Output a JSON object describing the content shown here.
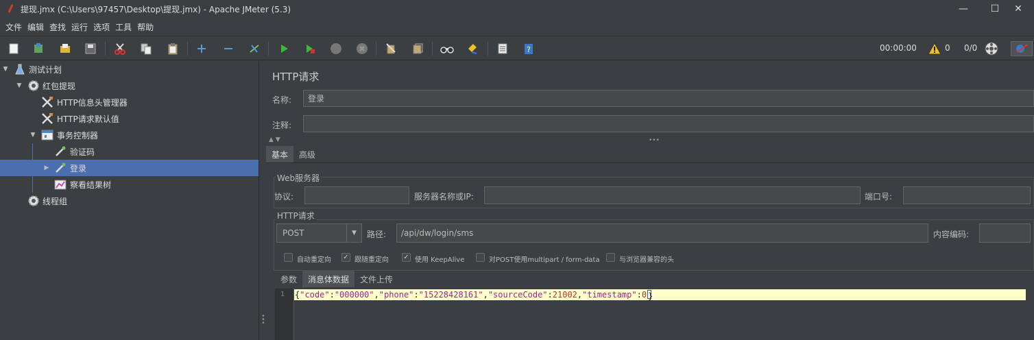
{
  "window": {
    "title": "提现.jmx (C:\\Users\\97457\\Desktop\\提现.jmx) - Apache JMeter (5.3)",
    "minimize": "—",
    "maximize": "☐",
    "close": "✕"
  },
  "menu": [
    "文件",
    "编辑",
    "查找",
    "运行",
    "选项",
    "工具",
    "帮助"
  ],
  "toolbar": {
    "icons": [
      "new-icon",
      "templates-icon",
      "open-icon",
      "save-icon",
      "cut-icon",
      "copy-icon",
      "paste-icon",
      "expand-icon",
      "collapse-icon",
      "toggle-icon",
      "start-icon",
      "start-no-pause-icon",
      "stop-icon",
      "shutdown-icon",
      "clear-icon",
      "clear-all-icon",
      "search-icon",
      "reset-search-icon",
      "function-helper-icon",
      "help-icon"
    ],
    "elapsed": "00:00:00",
    "warnings": "0",
    "threads": "0/0"
  },
  "tree": [
    {
      "label": "测试计划",
      "icon": "test-plan-icon",
      "expanded": true
    },
    {
      "label": "红包提现",
      "icon": "thread-group-gear-icon",
      "expanded": true
    },
    {
      "label": "HTTP信息头管理器",
      "icon": "config-tools-icon"
    },
    {
      "label": "HTTP请求默认值",
      "icon": "config-tools-icon"
    },
    {
      "label": "事务控制器",
      "icon": "controller-icon",
      "expanded": true
    },
    {
      "label": "验证码",
      "icon": "sampler-pipette-icon"
    },
    {
      "label": "登录",
      "icon": "sampler-pipette-icon",
      "selected": true
    },
    {
      "label": "察看结果树",
      "icon": "listener-chart-icon"
    },
    {
      "label": "线程组",
      "icon": "thread-group-gear-icon"
    }
  ],
  "panel": {
    "heading": "HTTP请求",
    "name_label": "名称:",
    "name_value": "登录",
    "comment_label": "注释:",
    "comment_value": "",
    "tabs": [
      "基本",
      "高级"
    ],
    "web_server": {
      "title": "Web服务器",
      "protocol_label": "协议:",
      "protocol_value": "",
      "server_label": "服务器名称或IP:",
      "server_value": "",
      "port_label": "端口号:",
      "port_value": ""
    },
    "http_request": {
      "title": "HTTP请求",
      "method": "POST",
      "path_label": "路径:",
      "path_value": "/api/dw/login/sms",
      "encoding_label": "内容编码:",
      "encoding_value": ""
    },
    "options": [
      {
        "label": "自动重定向",
        "checked": false
      },
      {
        "label": "跟随重定向",
        "checked": true
      },
      {
        "label": "使用 KeepAlive",
        "checked": true
      },
      {
        "label": "对POST使用multipart / form-data",
        "checked": false
      },
      {
        "label": "与浏览器兼容的头",
        "checked": false
      }
    ],
    "body_tabs": [
      "参数",
      "消息体数据",
      "文件上传"
    ],
    "active_body_tab": "消息体数据",
    "editor": {
      "line_number": "1",
      "open_brace": "{",
      "k1": "\"code\"",
      "c1": ":",
      "v1": "\"000000\"",
      "s1": ",",
      "k2": "\"phone\"",
      "c2": ":",
      "v2": "\"15228428161\"",
      "s2": ",",
      "k3": "\"sourceCode\"",
      "c3": ":",
      "v3": "21002",
      "s3": ",",
      "k4": "\"timestamp\"",
      "c4": ":",
      "v4": "0",
      "close_brace": "}"
    }
  }
}
